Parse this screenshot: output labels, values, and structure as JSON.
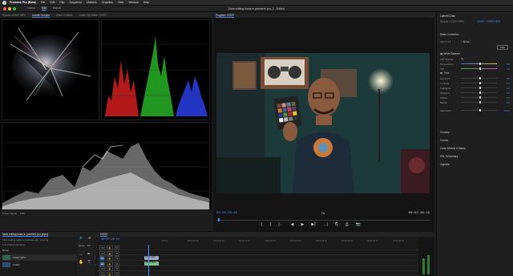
{
  "menubar": {
    "items": [
      "Premiere Pro (Beta)",
      "File",
      "Edit",
      "Clip",
      "Sequence",
      "Markers",
      "Graphics",
      "View",
      "Window",
      "Help"
    ]
  },
  "titlebar": {
    "workspaces": [
      "Import",
      "Edit",
      "Export"
    ],
    "active_workspace": "Edit",
    "doc_title": "Mute editing basis in premiere pro_2 - Edited"
  },
  "scope_panel": {
    "tabs": [
      "Source: C0007.MP4",
      "Lumetri Scopes",
      "Effect Controls",
      "Audio Clip Mixer: C0007"
    ],
    "active_tab": "Lumetri Scopes",
    "footer": [
      "Clamp Signal",
      "8 Bit"
    ]
  },
  "program": {
    "tab": "Program: C0007",
    "timecode_left": "00:00:09:03",
    "fit": "Fit",
    "timecode_right": "00:01:48:19",
    "transport": [
      "{",
      "}",
      "|←",
      "◀",
      "▶",
      "▶|",
      "→|",
      "⎘",
      "⎙",
      "📷"
    ]
  },
  "lumetri": {
    "title": "Lumetri Color",
    "source": "Source • C0007.MP4",
    "clip": "C0007 • C0007.MP4",
    "basic_correction": "Basic Correction",
    "input_lut_label": "Input LUT",
    "input_lut_value": "None",
    "auto_label": "Auto",
    "white_balance": "White Balance",
    "wb_selector": "WB Selector",
    "tone": "Tone",
    "rows": [
      {
        "label": "Temperature",
        "value": "0.0",
        "pos": 0.5
      },
      {
        "label": "Tint",
        "value": "0.0",
        "pos": 0.5
      },
      {
        "label": "Exposure",
        "value": "0.0",
        "pos": 0.5
      },
      {
        "label": "Contrast",
        "value": "0.0",
        "pos": 0.5
      },
      {
        "label": "Highlights",
        "value": "0.0",
        "pos": 0.5
      },
      {
        "label": "Shadows",
        "value": "0.0",
        "pos": 0.5
      },
      {
        "label": "Whites",
        "value": "0.0",
        "pos": 0.5
      },
      {
        "label": "Blacks",
        "value": "0.0",
        "pos": 0.5
      },
      {
        "label": "Saturation",
        "value": "100.0",
        "pos": 0.5
      }
    ],
    "sections": [
      "Creative",
      "Curves",
      "Color Wheels & Match",
      "HSL Secondary",
      "Vignette"
    ]
  },
  "project": {
    "tab": "Mute editing basis in premiere pro.prproj",
    "path": "Mute editing basis in premiere pro_2.prproj",
    "count": "1 of 2 items selected",
    "column_name": "Name",
    "column_rate": "Frame Rate",
    "items": [
      {
        "name": "C0007.MP4",
        "rate": "23.976 fps"
      },
      {
        "name": "C0007",
        "rate": "23.976 fps"
      }
    ]
  },
  "timeline": {
    "tab": "C0007",
    "timecode": "00:00:09:03",
    "ruler": [
      "00:00",
      "00:00:04:23",
      "00:00:09:23",
      "00:00:14:23",
      "00:00:19:23",
      "00:00:24:23",
      "00:00:29:23",
      "00:00:34:23",
      "00:00:39:23",
      "00:00:44:23",
      "00:00:49:23"
    ],
    "tracks": [
      "V3",
      "V2",
      "V1",
      "A1",
      "A2",
      "A3"
    ],
    "clip_label": "C0007.MP4"
  },
  "colors": {
    "accent": "#4a8ff7",
    "clip_video": "#9aa9c8",
    "clip_audio": "#7fc48a"
  }
}
